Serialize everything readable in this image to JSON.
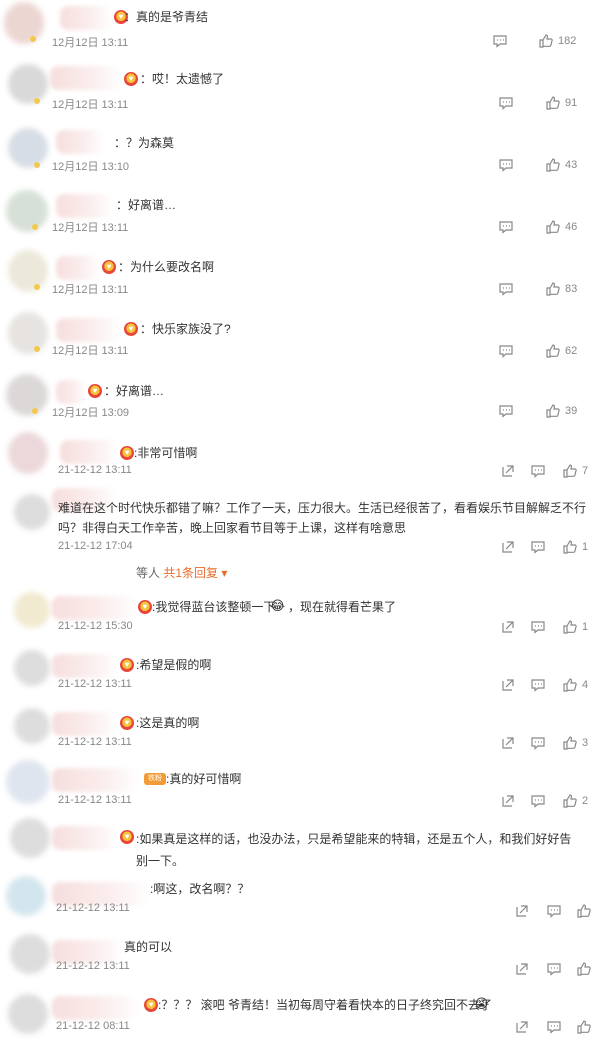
{
  "comments": [
    {
      "text": "：真的是爷青结",
      "time": "12月12日 13:11",
      "likes": "182"
    },
    {
      "text": "：哎！太遗憾了",
      "time": "12月12日 13:11",
      "likes": "91"
    },
    {
      "text": "：？为森莫",
      "time": "12月12日 13:10",
      "likes": "43"
    },
    {
      "text": "：好离谱…",
      "time": "12月12日 13:11",
      "likes": "46"
    },
    {
      "text": "：为什么要改名啊",
      "time": "12月12日 13:11",
      "likes": "83"
    },
    {
      "text": "：快乐家族没了?",
      "time": "12月12日 13:11",
      "likes": "62"
    },
    {
      "text": "：好离谱…",
      "time": "12月12日 13:09",
      "likes": "39"
    },
    {
      "text": ":非常可惜啊",
      "time": "21-12-12 13:11",
      "likes": "7"
    },
    {
      "text": "难道在这个时代快乐都错了嘛？工作了一天，压力很大。生活已经很苦了，看看娱乐节目解解乏不行吗？非得白天工作辛苦，晚上回家看节目等于上课，这样有啥意思",
      "time": "21-12-12 17:04",
      "likes": "1"
    },
    {
      "text": ":我觉得蓝台该整顿一下",
      "text2": "，现在就得看芒果了",
      "time": "21-12-12 15:30",
      "likes": "1"
    },
    {
      "text": ":希望是假的啊",
      "time": "21-12-12 13:11",
      "likes": "4"
    },
    {
      "text": ":这是真的啊",
      "time": "21-12-12 13:11",
      "likes": "3"
    },
    {
      "text": ":真的好可惜啊",
      "time": "21-12-12 13:11",
      "likes": "2"
    },
    {
      "text": ":如果真是这样的话，也没办法，只是希望能来的特辑，还是五个人，和我们好好告别一下。",
      "time": "",
      "likes": ""
    },
    {
      "text": ":啊这，改名啊？？",
      "time": "21-12-12 13:11",
      "likes": ""
    },
    {
      "text": "真的可以",
      "time": "21-12-12 13:11",
      "likes": ""
    },
    {
      "text": ":？？？ 滚吧 爷青结！当初每周守着看快本的日子终究回不去了",
      "time": "21-12-12 08:11",
      "likes": ""
    }
  ],
  "replies": {
    "prefix": "等人",
    "count_label": "共1条回复"
  },
  "colors": {
    "accent": "#e86b2c",
    "text": "#333333",
    "meta": "#888888"
  }
}
